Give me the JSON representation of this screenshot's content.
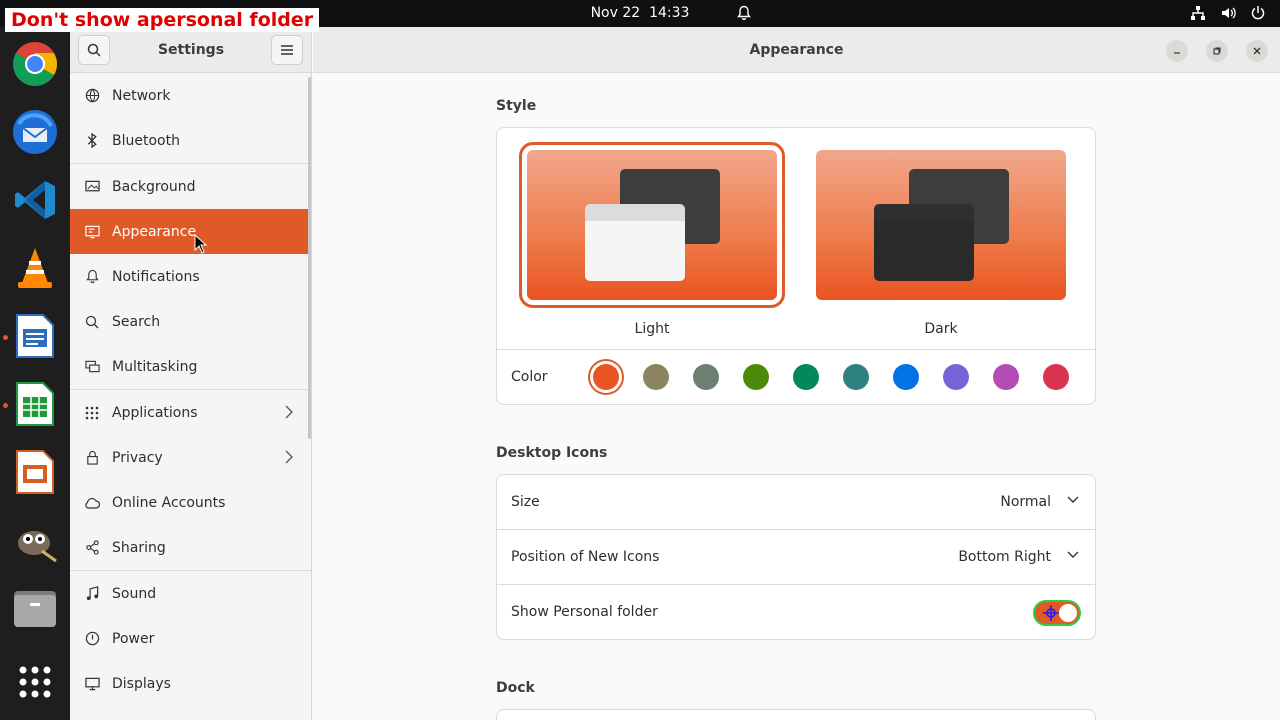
{
  "overlay": {
    "instruction": "Don't show apersonal folder"
  },
  "topbar": {
    "date": "Nov 22",
    "time": "14:33"
  },
  "dock": {
    "apps": [
      "Chrome",
      "Thunderbird",
      "VS Code",
      "VLC",
      "Writer",
      "Calc",
      "Impress",
      "GIMP",
      "Files",
      "Show Applications"
    ]
  },
  "sidebar": {
    "title": "Settings",
    "items": [
      {
        "label": "Network",
        "icon": "globe-icon"
      },
      {
        "label": "Bluetooth",
        "icon": "bluetooth-icon"
      },
      {
        "label": "Background",
        "icon": "monitor-icon"
      },
      {
        "label": "Appearance",
        "icon": "appearance-icon",
        "active": true
      },
      {
        "label": "Notifications",
        "icon": "bell-icon"
      },
      {
        "label": "Search",
        "icon": "search-icon"
      },
      {
        "label": "Multitasking",
        "icon": "multitasking-icon"
      },
      {
        "label": "Applications",
        "icon": "apps-grid-icon"
      },
      {
        "label": "Privacy",
        "icon": "lock-icon"
      },
      {
        "label": "Online Accounts",
        "icon": "cloud-icon"
      },
      {
        "label": "Sharing",
        "icon": "share-icon"
      },
      {
        "label": "Sound",
        "icon": "music-note-icon"
      },
      {
        "label": "Power",
        "icon": "power-icon"
      },
      {
        "label": "Displays",
        "icon": "display-icon"
      }
    ]
  },
  "main": {
    "title": "Appearance",
    "style": {
      "section_title": "Style",
      "light_label": "Light",
      "dark_label": "Dark",
      "selected": "Light",
      "color_label": "Color",
      "colors": [
        "#e95420",
        "#8a8560",
        "#6b8070",
        "#4e8a0a",
        "#03875b",
        "#308280",
        "#0073e5",
        "#7764d8",
        "#b34cb3",
        "#da3450"
      ],
      "selected_color": "#e95420"
    },
    "desktop_icons": {
      "section_title": "Desktop Icons",
      "size_label": "Size",
      "size_value": "Normal",
      "position_label": "Position of New Icons",
      "position_value": "Bottom Right",
      "personal_label": "Show Personal folder",
      "personal_on": true
    },
    "dock": {
      "section_title": "Dock"
    }
  },
  "accent": "#e05a28"
}
